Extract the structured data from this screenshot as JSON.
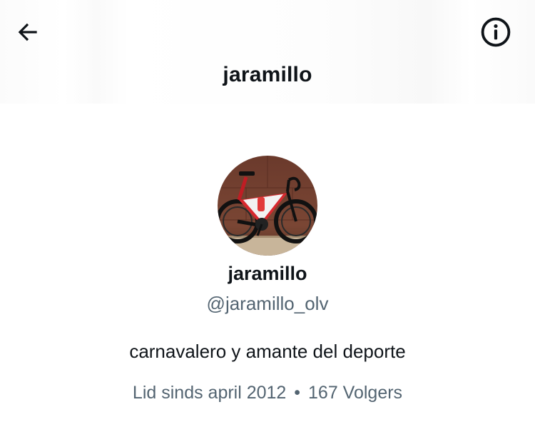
{
  "header": {
    "title": "jaramillo",
    "back_icon": "arrow-left-icon",
    "info_icon": "info-circle-icon"
  },
  "profile": {
    "avatar_alt": "bicycle",
    "display_name": "jaramillo",
    "handle": "@jaramillo_olv",
    "bio": "carnavalero y amante del deporte",
    "joined": "Lid sinds april 2012",
    "separator": "•",
    "followers": "167 Volgers"
  },
  "colors": {
    "text_primary": "#0f1419",
    "text_secondary": "#536471",
    "background": "#ffffff"
  }
}
